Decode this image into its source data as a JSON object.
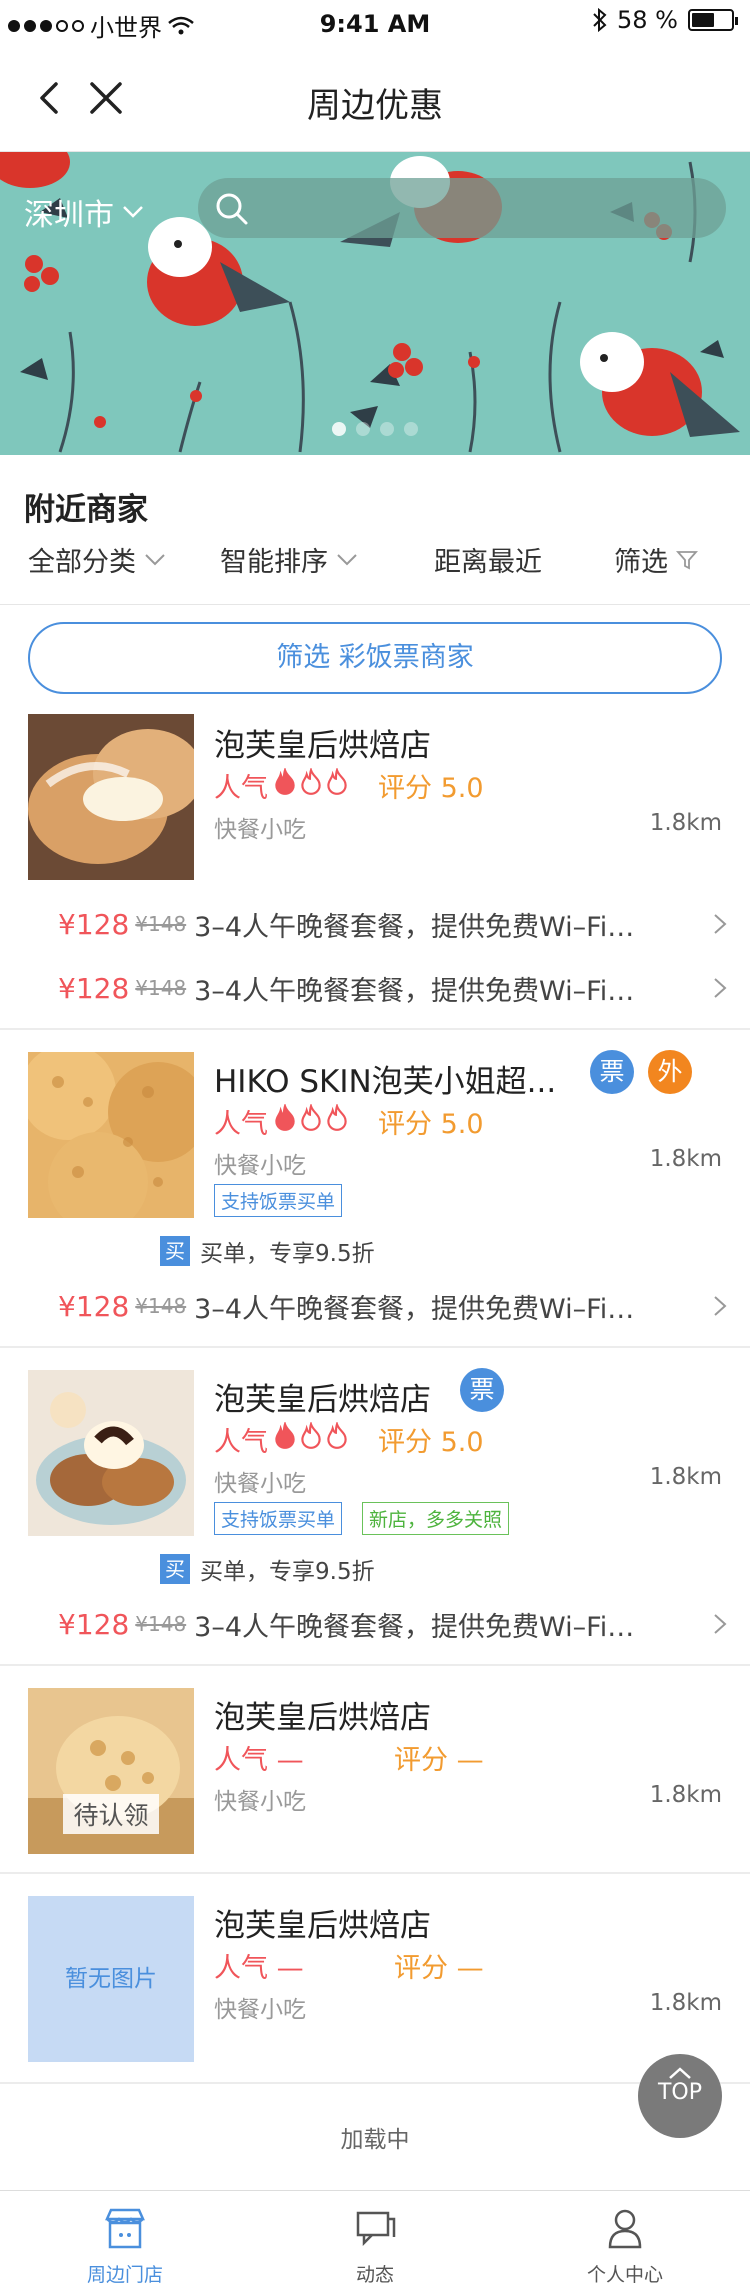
{
  "status": {
    "carrier": "小世界",
    "time": "9:41 AM",
    "battery": "58 %",
    "battery_level": 0.58
  },
  "nav": {
    "title": "周边优惠"
  },
  "banner": {
    "city": "深圳市",
    "slide_count": 4,
    "active_slide": 1
  },
  "section": {
    "title": "附近商家"
  },
  "filters": {
    "category": "全部分类",
    "sort": "智能排序",
    "distance": "距离最近",
    "filter": "筛选"
  },
  "filter_button": {
    "label": "筛选 彩饭票商家"
  },
  "shops": [
    {
      "name": "泡芙皇后烘焙店",
      "popularity_label": "人气",
      "score_label": "评分 5.0",
      "flames_filled": 1,
      "flames_total": 3,
      "category": "快餐小吃",
      "distance": "1.8km",
      "deals": [
        {
          "price": "¥128",
          "old_price": "¥148",
          "desc": "3–4人午晚餐套餐，提供免费Wi–Fi…"
        },
        {
          "price": "¥128",
          "old_price": "¥148",
          "desc": "3–4人午晚餐套餐，提供免费Wi–Fi…"
        }
      ]
    },
    {
      "name": "HIKO SKIN泡芙小姐超...",
      "badge_ticket": "票",
      "badge_out": "外",
      "popularity_label": "人气",
      "score_label": "评分 5.0",
      "flames_filled": 1,
      "flames_total": 3,
      "category": "快餐小吃",
      "distance": "1.8km",
      "tag1": "支持饭票买单",
      "buy_icon": "买",
      "buy_text": "买单，专享9.5折",
      "deals": [
        {
          "price": "¥128",
          "old_price": "¥148",
          "desc": "3–4人午晚餐套餐，提供免费Wi–Fi…"
        }
      ]
    },
    {
      "name": "泡芙皇后烘焙店",
      "badge_ticket": "票",
      "popularity_label": "人气",
      "score_label": "评分 5.0",
      "flames_filled": 1,
      "flames_total": 3,
      "category": "快餐小吃",
      "distance": "1.8km",
      "tag1": "支持饭票买单",
      "tag2": "新店，多多关照",
      "buy_icon": "买",
      "buy_text": "买单，专享9.5折",
      "deals": [
        {
          "price": "¥128",
          "old_price": "¥148",
          "desc": "3–4人午晚餐套餐，提供免费Wi–Fi…"
        }
      ]
    },
    {
      "name": "泡芙皇后烘焙店",
      "popularity_label": "人气 —",
      "score_label": "评分 —",
      "category": "快餐小吃",
      "distance": "1.8km",
      "claim_label": "待认领"
    },
    {
      "name": "泡芙皇后烘焙店",
      "popularity_label": "人气 —",
      "score_label": "评分 —",
      "category": "快餐小吃",
      "distance": "1.8km",
      "no_image_label": "暂无图片"
    }
  ],
  "loading": "加载中",
  "top_button": "TOP",
  "tabbar": {
    "tabs": [
      {
        "label": "周边门店",
        "icon": "store-icon",
        "active": true
      },
      {
        "label": "动态",
        "icon": "chat-icon",
        "active": false
      },
      {
        "label": "个人中心",
        "icon": "user-icon",
        "active": false
      }
    ]
  },
  "colors": {
    "accent": "#4a8fdd",
    "price": "#f0555a",
    "score": "#f29b30",
    "banner_bg": "#7fc7bc"
  }
}
